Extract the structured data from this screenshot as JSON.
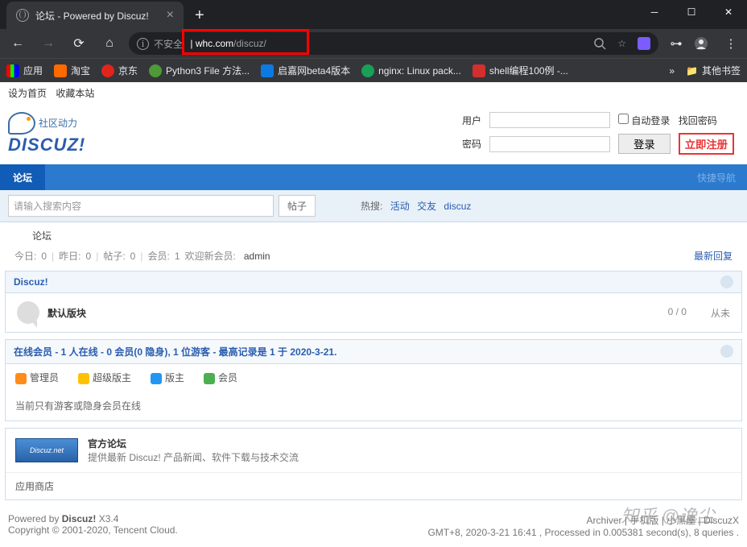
{
  "browser": {
    "tab_title": "论坛 - Powered by Discuz!",
    "url_unsafe": "不安全",
    "url_host": "whc.com",
    "url_path": "/discuz/",
    "bookmarks": {
      "apps": "应用",
      "items": [
        "淘宝",
        "京东",
        "Python3 File 方法...",
        "启嘉网beta4版本",
        "nginx: Linux pack...",
        "shell编程100例 -..."
      ],
      "more": "»",
      "other": "其他书签"
    }
  },
  "page": {
    "topline": {
      "sethome": "设为首页",
      "favorite": "收藏本站"
    },
    "logo": {
      "cn": "社区动力",
      "en": "DISCUZ",
      "ex": "!"
    },
    "login": {
      "user_label": "用户",
      "pass_label": "密码",
      "auto_label": "自动登录",
      "findpwd": "找回密码",
      "login_btn": "登录",
      "register_btn": "立即注册"
    },
    "nav": {
      "forum": "论坛",
      "quick": "快捷导航"
    },
    "search": {
      "placeholder": "请输入搜索内容",
      "type": "帖子",
      "hot_label": "热搜:",
      "hot_items": [
        "活动",
        "交友",
        "discuz"
      ]
    },
    "crumb": "论坛",
    "stats": {
      "today_label": "今日:",
      "today_val": "0",
      "yest_label": "昨日:",
      "yest_val": "0",
      "posts_label": "帖子:",
      "posts_val": "0",
      "members_label": "会员:",
      "members_val": "1",
      "welcome": "欢迎新会员:",
      "admin": "admin",
      "latest": "最新回复"
    },
    "category": "Discuz!",
    "forum": {
      "name": "默认版块",
      "topics": "0",
      "sep": "/",
      "posts": "0",
      "last": "从未"
    },
    "online": {
      "title": "在线会员 - 1 人在线 - 0 会员(0 隐身), 1 位游客 - 最高记录是 1 于  2020-3-21.",
      "legend": [
        "管理员",
        "超级版主",
        "版主",
        "会员"
      ],
      "empty": "当前只有游客或隐身会员在线"
    },
    "link": {
      "logo_text": "Discuz.net",
      "title": "官方论坛",
      "desc": "提供最新 Discuz! 产品新闻、软件下载与技术交流"
    },
    "appstore": "应用商店",
    "footer": {
      "powered": "Powered by ",
      "discuz": "Discuz!",
      "version": " X3.4",
      "copyright": "Copyright © 2001-2020, Tencent Cloud.",
      "archiver": "Archiver",
      "mobile": "手机版",
      "blacklist": "小黑屋",
      "dx": "DiscuzX",
      "gmt": "GMT+8, 2020-3-21 16:41 , Processed in 0.005381 second(s), 8 queries .",
      "watermark": "知乎 @逸尘"
    }
  }
}
